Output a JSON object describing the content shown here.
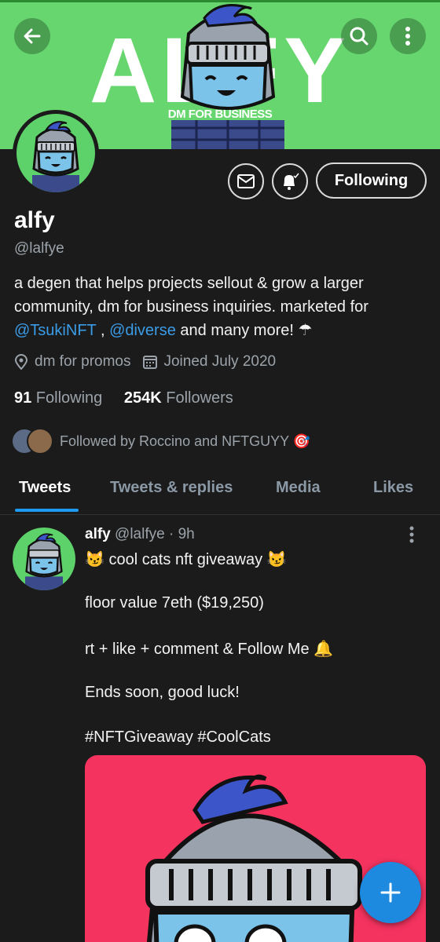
{
  "banner": {
    "word": "ALFY",
    "subtitle": "DM FOR BUSINESS"
  },
  "header": {
    "back": "back-arrow-icon",
    "search": "search-icon",
    "more": "more-vertical-icon"
  },
  "profile": {
    "name": "alfy",
    "handle": "@lalfye",
    "bio_text_1": "a degen that helps projects sellout & grow a larger community, dm for business inquiries. marketed for ",
    "bio_link_1": "@TsukiNFT",
    "bio_sep": " , ",
    "bio_link_2": "@diverse",
    "bio_text_2": " and many more! ☂",
    "location": "dm for promos",
    "joined": "Joined July 2020",
    "following_count": "91",
    "following_label": " Following",
    "followers_count": "254K",
    "followers_label": " Followers",
    "followed_by": "Followed by Roccino and NFTGUYY 🎯",
    "follow_button": "Following"
  },
  "tabs": [
    {
      "label": "Tweets"
    },
    {
      "label": "Tweets & replies"
    },
    {
      "label": "Media"
    },
    {
      "label": "Likes"
    }
  ],
  "tweet": {
    "name": "alfy",
    "handle": "@lalfye",
    "time": "· 9h",
    "line1": "😼 cool cats nft giveaway 😼",
    "line2": "floor value 7eth ($19,250)",
    "line3": "rt + like + comment & Follow Me 🔔",
    "line4": "Ends soon, good luck!",
    "hashtags": "#NFTGiveaway #CoolCats"
  },
  "colors": {
    "banner": "#67d66e",
    "accent": "#1d9bf0",
    "link": "#3a9be6",
    "image_bg": "#f4335f"
  }
}
